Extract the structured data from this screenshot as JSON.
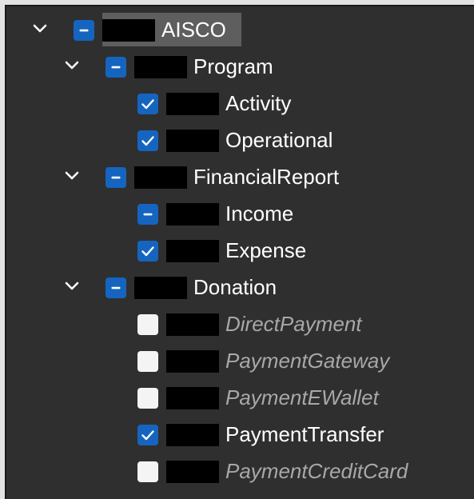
{
  "tree": {
    "root": {
      "label": "AISCO",
      "expanded": true,
      "state": "partial",
      "selected": true
    },
    "groups": [
      {
        "label": "Program",
        "expanded": true,
        "state": "partial",
        "children": [
          {
            "label": "Activity",
            "state": "checked",
            "disabled": false
          },
          {
            "label": "Operational",
            "state": "checked",
            "disabled": false
          }
        ]
      },
      {
        "label": "FinancialReport",
        "expanded": true,
        "state": "partial",
        "children": [
          {
            "label": "Income",
            "state": "partial",
            "disabled": false
          },
          {
            "label": "Expense",
            "state": "checked",
            "disabled": false
          }
        ]
      },
      {
        "label": "Donation",
        "expanded": true,
        "state": "partial",
        "children": [
          {
            "label": "DirectPayment",
            "state": "unchecked",
            "disabled": true
          },
          {
            "label": "PaymentGateway",
            "state": "unchecked",
            "disabled": true
          },
          {
            "label": "PaymentEWallet",
            "state": "unchecked",
            "disabled": true
          },
          {
            "label": "PaymentTransfer",
            "state": "checked",
            "disabled": false
          },
          {
            "label": "PaymentCreditCard",
            "state": "unchecked",
            "disabled": true
          }
        ]
      }
    ]
  },
  "colors": {
    "background": "#2f2f2f",
    "checkbox_accent": "#1565c0",
    "selected_row": "#5e5e5e",
    "text": "#ffffff",
    "text_disabled": "#a8a8a8"
  },
  "icons": {
    "expand": "chevron-down-icon",
    "checked": "checkmark-icon",
    "partial": "minus-icon"
  }
}
